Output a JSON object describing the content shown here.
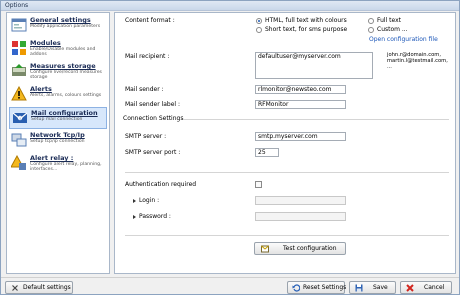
{
  "window": {
    "title": "Options"
  },
  "sidebar": {
    "items": [
      {
        "title": "General settings",
        "desc": "Modify application parameters",
        "icon": "settings-window-icon"
      },
      {
        "title": "Modules",
        "desc": "Enable/Disable modules and addons",
        "icon": "modules-icon"
      },
      {
        "title": "Measures storage",
        "desc": "Configure live/record measures storage",
        "icon": "storage-icon"
      },
      {
        "title": "Alerts",
        "desc": "Alerts, alarms, colours settings",
        "icon": "alert-icon"
      },
      {
        "title": "Mail configuration",
        "desc": "Setup mail connection",
        "icon": "mail-icon"
      },
      {
        "title": "Network Tcp/Ip",
        "desc": "Setup tcp/ip connection",
        "icon": "network-icon"
      },
      {
        "title": "Alert relay :",
        "desc": "Configure alert relay, planning, interfaces...",
        "icon": "alert-relay-icon"
      }
    ],
    "selected_index": 4
  },
  "mail": {
    "content_format_label": "Content format :",
    "formats": {
      "html": "HTML, full text with colours",
      "short": "Short text, for sms purpose",
      "full": "Full text",
      "custom": "Custom ..."
    },
    "selected_format": "html",
    "open_config_link": "Open configuration file",
    "recipient_label": "Mail recipient :",
    "recipient_value": "defaultuser@myserver.com",
    "recipient_examples": "john.r@domain.com,\nmartin.l@testmail.com,\n...",
    "sender_label": "Mail sender :",
    "sender_value": "rlmonitor@newsteo.com",
    "sender_label_label": "Mail sender label :",
    "sender_label_value": "RFMonitor"
  },
  "connection": {
    "section_title": "Connection Settings",
    "smtp_server_label": "SMTP server :",
    "smtp_server_value": "smtp.myserver.com",
    "smtp_port_label": "SMTP server port :",
    "smtp_port_value": "25",
    "auth_label": "Authentication required",
    "auth_checked": false,
    "login_label": "Login :",
    "login_value": "",
    "password_label": "Password :",
    "password_value": "",
    "test_button": "Test configuration"
  },
  "footer": {
    "default_settings": "Default settings",
    "reset_settings": "Reset Settings",
    "save": "Save",
    "cancel": "Cancel"
  },
  "colors": {
    "accent": "#1d59b4",
    "selection": "#d7e7fb",
    "cancel_red": "#d2261f"
  }
}
